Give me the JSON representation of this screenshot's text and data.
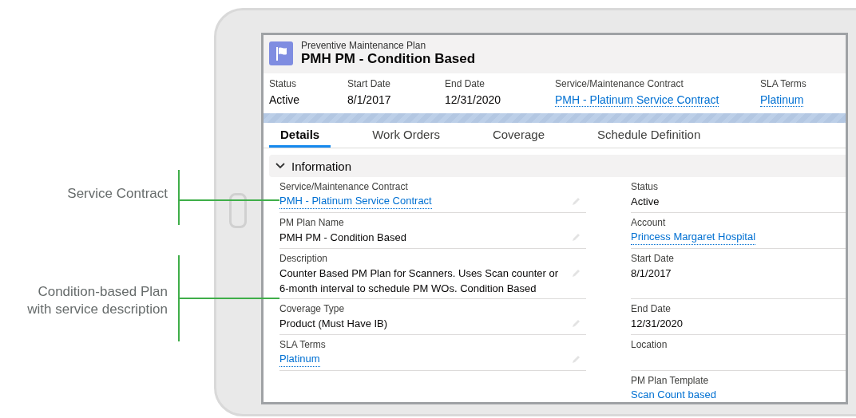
{
  "annotations": [
    {
      "text": "Service Contract"
    },
    {
      "text": "Condition-based Plan with service description"
    }
  ],
  "record": {
    "object_type": "Preventive Maintenance Plan",
    "name": "PMH PM - Condition Based"
  },
  "highlights": [
    {
      "label": "Status",
      "value": "Active",
      "kind": "text"
    },
    {
      "label": "Start Date",
      "value": "8/1/2017",
      "kind": "text"
    },
    {
      "label": "End Date",
      "value": "12/31/2020",
      "kind": "text"
    },
    {
      "label": "Service/Maintenance Contract",
      "value": "PMH - Platinum Service Contract",
      "kind": "link"
    },
    {
      "label": "SLA Terms",
      "value": "Platinum",
      "kind": "link"
    }
  ],
  "tabs": [
    {
      "label": "Details",
      "selected": true
    },
    {
      "label": "Work Orders",
      "selected": false
    },
    {
      "label": "Coverage",
      "selected": false
    },
    {
      "label": "Schedule Definition",
      "selected": false
    }
  ],
  "section": {
    "title": "Information",
    "expanded": true
  },
  "fields_left": [
    {
      "label": "Service/Maintenance Contract",
      "value": "PMH - Platinum Service Contract",
      "kind": "link",
      "editable": true
    },
    {
      "label": "PM Plan Name",
      "value": "PMH PM - Condition Based",
      "kind": "text",
      "editable": true
    },
    {
      "label": "Description",
      "value": "Counter Based PM Plan for Scanners. Uses Scan counter or 6-month interval to schedule PM WOs. Condition Based",
      "kind": "text",
      "editable": true
    },
    {
      "label": "Coverage Type",
      "value": "Product (Must Have IB)",
      "kind": "text",
      "editable": true
    },
    {
      "label": "SLA Terms",
      "value": "Platinum",
      "kind": "link",
      "editable": true
    }
  ],
  "fields_right": [
    {
      "label": "Status",
      "value": "Active",
      "kind": "text"
    },
    {
      "label": "Account",
      "value": "Princess Margaret Hospital",
      "kind": "link"
    },
    {
      "label": "Start Date",
      "value": "8/1/2017",
      "kind": "text"
    },
    {
      "label": "End Date",
      "value": "12/31/2020",
      "kind": "text"
    },
    {
      "label": "Location",
      "kind": "text"
    },
    {
      "label": "PM Plan Template",
      "value": "Scan Count based",
      "kind": "link"
    }
  ]
}
